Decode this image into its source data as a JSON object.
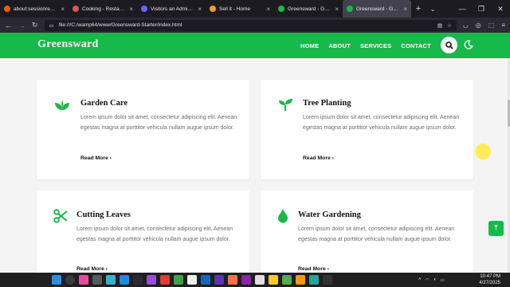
{
  "browser": {
    "tabs": [
      {
        "title": "about:sessionrestore",
        "color": "#e66000",
        "active": false
      },
      {
        "title": "Cooking - Restaurants Ca",
        "color": "#d9534f",
        "active": false
      },
      {
        "title": "Visitors an Admin Panel C",
        "color": "#6c63ff",
        "active": false
      },
      {
        "title": "Sell it - Home",
        "color": "#f0a020",
        "active": false
      },
      {
        "title": "Greensward - Gardening",
        "color": "#16b94a",
        "active": false
      },
      {
        "title": "Greensward - Gardening C",
        "color": "#16b94a",
        "active": true
      }
    ],
    "url": "file:///C:/wamp64/www/Greensward-Starter/index.html"
  },
  "site": {
    "logo": "Greensward",
    "menu": [
      "HOME",
      "ABOUT",
      "SERVICES",
      "CONTACT"
    ]
  },
  "services": [
    {
      "title": "Garden Care",
      "icon": "leaves-icon",
      "text": "Lorem ipsum dolor sit amet, consectetur adipiscing elit. Aenean egestas magna at porttitor vehicula nullam augue ipsum dolor.",
      "link": "Read More"
    },
    {
      "title": "Tree Planting",
      "icon": "seedling-icon",
      "text": "Lorem ipsum dolor sit amet, consectetur adipiscing elit. Aenean egestas magna at porttitor vehicula nullam augue ipsum dolor.",
      "link": "Read More"
    },
    {
      "title": "Cutting Leaves",
      "icon": "scissors-icon",
      "text": "Lorem ipsum dolor sit amet, consectetur adipiscing elit. Aenean egestas magna at porttitor vehicula nullam augue ipsum dolor.",
      "link": "Read More"
    },
    {
      "title": "Water Gardening",
      "icon": "water-drop-icon",
      "text": "Lorem ipsum dolor sit amet, consectetur adipiscing elit. Aenean egestas magna at porttitor vehicula nullam augue ipsum dolor.",
      "link": "Read More"
    }
  ],
  "taskbar": {
    "time": "10:47 PM",
    "date": "4/27/2025"
  },
  "colors": {
    "brand": "#16b94a"
  }
}
